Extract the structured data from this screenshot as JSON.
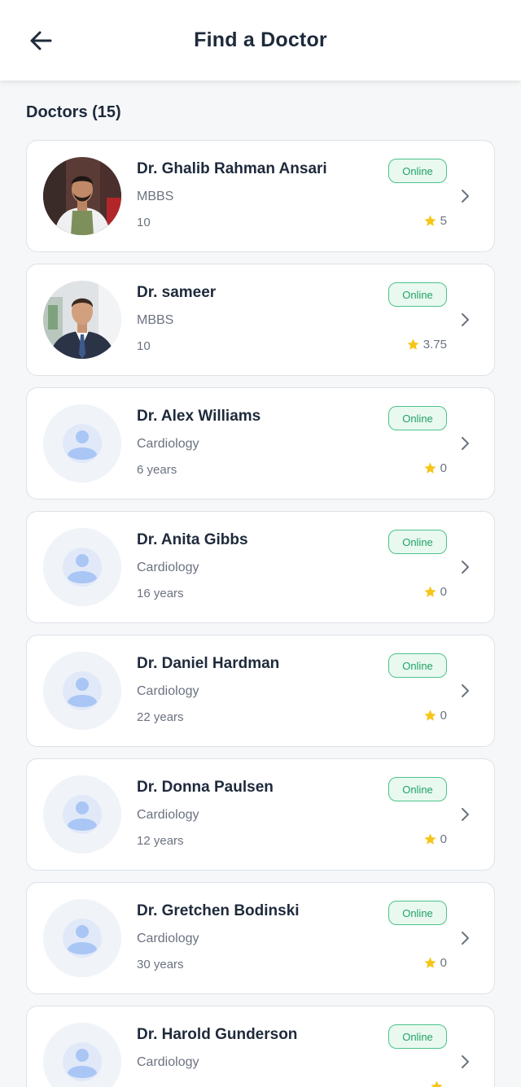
{
  "header": {
    "title": "Find a Doctor",
    "back_icon": "arrow-left-icon"
  },
  "section": {
    "title": "Doctors (15)"
  },
  "colors": {
    "online_border": "#4cc38a",
    "online_text": "#22a267",
    "star": "#f5c518",
    "placeholder_person": "#a9c6f5"
  },
  "doctors": [
    {
      "name": "Dr. Ghalib Rahman Ansari",
      "specialty": "MBBS",
      "experience": "10",
      "rating": "5",
      "status": "Online",
      "avatar": "photo"
    },
    {
      "name": "Dr. sameer",
      "specialty": "MBBS",
      "experience": "10",
      "rating": "3.75",
      "status": "Online",
      "avatar": "photo"
    },
    {
      "name": "Dr. Alex Williams",
      "specialty": "Cardiology",
      "experience": "6 years",
      "rating": "0",
      "status": "Online",
      "avatar": "placeholder"
    },
    {
      "name": "Dr. Anita Gibbs",
      "specialty": "Cardiology",
      "experience": "16 years",
      "rating": "0",
      "status": "Online",
      "avatar": "placeholder"
    },
    {
      "name": "Dr. Daniel Hardman",
      "specialty": "Cardiology",
      "experience": "22 years",
      "rating": "0",
      "status": "Online",
      "avatar": "placeholder"
    },
    {
      "name": "Dr. Donna Paulsen",
      "specialty": "Cardiology",
      "experience": "12 years",
      "rating": "0",
      "status": "Online",
      "avatar": "placeholder"
    },
    {
      "name": "Dr. Gretchen Bodinski",
      "specialty": "Cardiology",
      "experience": "30 years",
      "rating": "0",
      "status": "Online",
      "avatar": "placeholder"
    },
    {
      "name": "Dr. Harold Gunderson",
      "specialty": "Cardiology",
      "experience": "",
      "rating": "",
      "status": "Online",
      "avatar": "placeholder"
    }
  ]
}
